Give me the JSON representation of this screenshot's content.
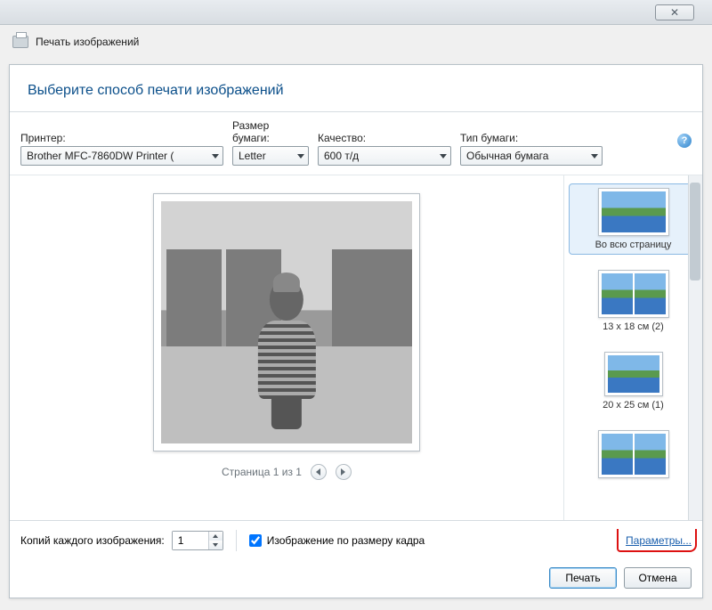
{
  "window": {
    "title": "Печать изображений",
    "close_glyph": "✕"
  },
  "header": {
    "heading": "Выберите способ печати изображений"
  },
  "options": {
    "printer": {
      "label": "Принтер:",
      "value": "Brother MFC-7860DW Printer ("
    },
    "paper_size": {
      "label": "Размер бумаги:",
      "value": "Letter"
    },
    "quality": {
      "label": "Качество:",
      "value": "600 т/д"
    },
    "paper_type": {
      "label": "Тип бумаги:",
      "value": "Обычная бумага"
    },
    "help_glyph": "?"
  },
  "preview": {
    "page_text": "Страница 1 из 1"
  },
  "layouts": {
    "items": [
      {
        "label": "Во всю страницу"
      },
      {
        "label": "13 x 18 см (2)"
      },
      {
        "label": "20 x 25 см (1)"
      },
      {
        "label": ""
      }
    ]
  },
  "footer": {
    "copies_label": "Копий каждого изображения:",
    "copies_value": "1",
    "fit_frame_label": "Изображение по размеру кадра",
    "fit_frame_checked": true,
    "options_link": "Параметры..."
  },
  "buttons": {
    "print": "Печать",
    "cancel": "Отмена"
  }
}
